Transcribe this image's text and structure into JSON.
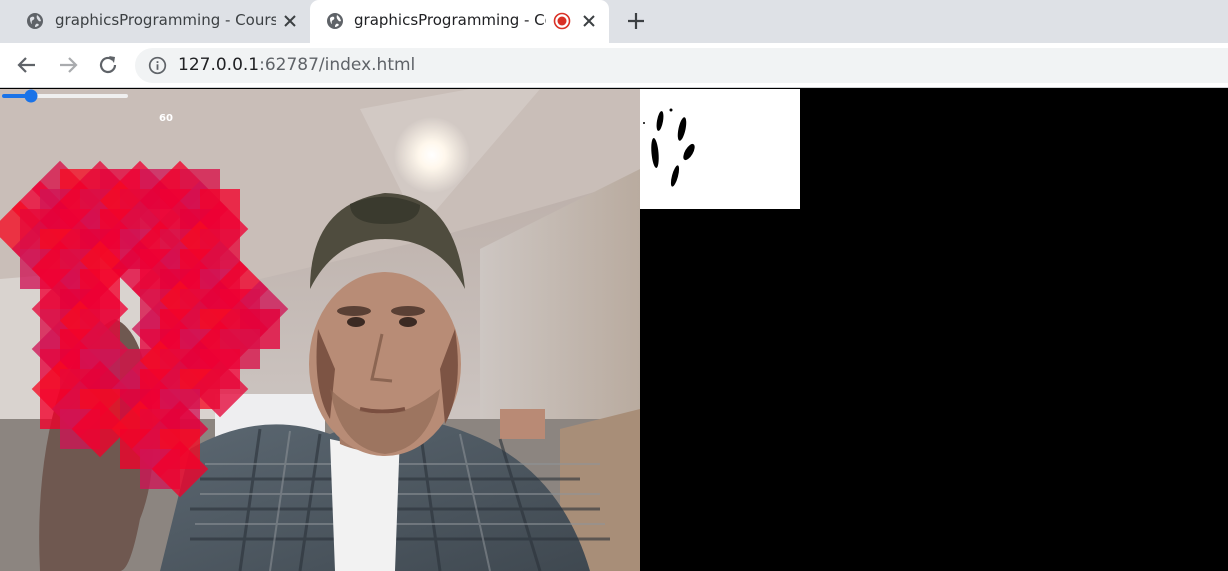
{
  "browser": {
    "tabs": [
      {
        "title": "graphicsProgramming - Coursera",
        "active": false,
        "icon": "globe-icon"
      },
      {
        "title": "graphicsProgramming - Coursera",
        "active": true,
        "icon": "globe-icon",
        "recording": true
      }
    ],
    "new_tab_icon": "plus-icon",
    "nav": {
      "back_icon": "back-arrow-icon",
      "forward_icon": "forward-arrow-icon",
      "reload_icon": "reload-icon"
    },
    "url_host": "127.0.0.1",
    "url_rest": ":62787/index.html",
    "site_info_icon": "info-icon"
  },
  "page": {
    "slider": {
      "value": 60,
      "min": 0,
      "max": 255,
      "fill_fraction": 0.23
    },
    "slider_label": "60",
    "colors": {
      "tab_strip": "#dee1e6",
      "accent": "#1a73e8",
      "record": "#d93025",
      "overlay": "#ee0033"
    }
  }
}
